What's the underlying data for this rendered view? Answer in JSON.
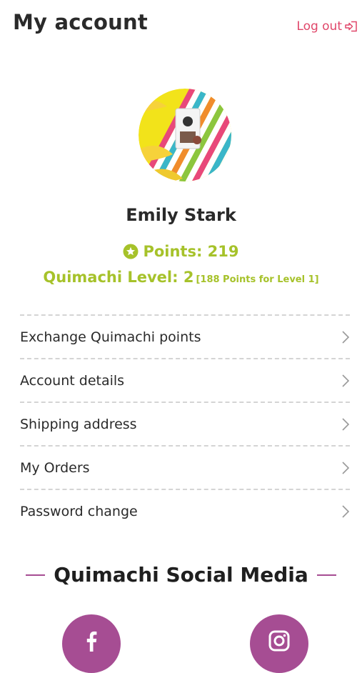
{
  "header": {
    "title": "My account",
    "logout_label": "Log out",
    "logout_icon": "logout-arrow-icon"
  },
  "profile": {
    "avatar_icon": "product-photo-avatar",
    "name": "Emily Stark",
    "points_icon": "star-badge-icon",
    "points_text": "Points: 219",
    "level_text": "Quimachi Level: 2",
    "level_note": "[188 Points for Level 1]"
  },
  "menu": {
    "items": [
      {
        "label": "Exchange Quimachi points"
      },
      {
        "label": "Account details"
      },
      {
        "label": "Shipping address"
      },
      {
        "label": "My Orders"
      },
      {
        "label": "Password change"
      }
    ],
    "chevron_icon": "chevron-right-icon"
  },
  "social": {
    "title": "Quimachi Social Media",
    "buttons": [
      {
        "icon": "facebook-icon"
      },
      {
        "icon": "instagram-icon"
      }
    ]
  },
  "colors": {
    "accent_pink": "#e0476a",
    "accent_green": "#a6c22a",
    "accent_purple": "#a64d93",
    "text": "#2a2a2a",
    "divider": "#d4d4d4"
  }
}
